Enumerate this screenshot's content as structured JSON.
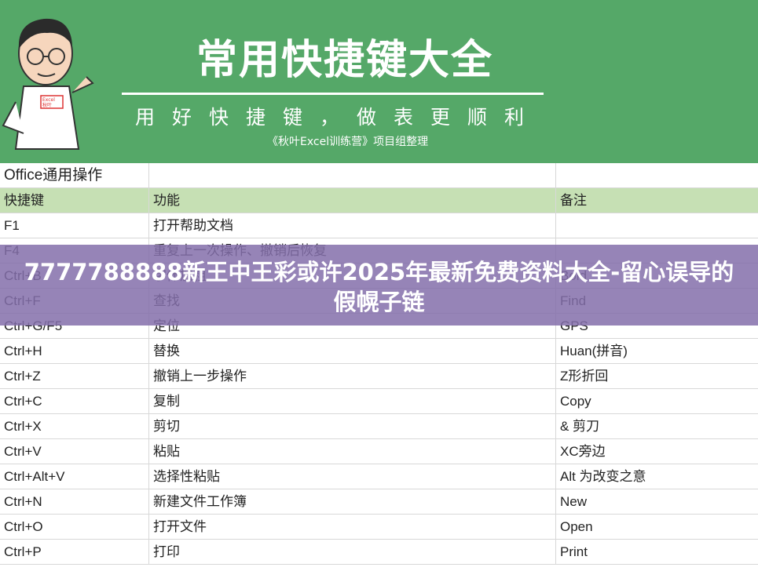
{
  "banner": {
    "title": "常用快捷键大全",
    "subtitle": "用好快捷键，做表更顺利",
    "credit": "《秋叶Excel训练营》项目组整理",
    "bg_color": "#55a868",
    "mascot_shirt_text_1": "Excel",
    "mascot_shirt_text_2": "秋叶"
  },
  "table": {
    "section_title": "Office通用操作",
    "headers": [
      "快捷键",
      "功能",
      "备注"
    ],
    "rows": [
      [
        "F1",
        "打开帮助文档",
        ""
      ],
      [
        "F4",
        "重复上一次操作、撤销后恢复",
        ""
      ],
      [
        "Ctrl+B",
        "字体加粗",
        "Bold"
      ],
      [
        "Ctrl+F",
        "查找",
        "Find"
      ],
      [
        "Ctrl+G/F5",
        "定位",
        "GPS"
      ],
      [
        "Ctrl+H",
        "替换",
        "Huan(拼音)"
      ],
      [
        "Ctrl+Z",
        "撤销上一步操作",
        "Z形折回"
      ],
      [
        "Ctrl+C",
        "复制",
        "Copy"
      ],
      [
        "Ctrl+X",
        "剪切",
        "& 剪刀"
      ],
      [
        "Ctrl+V",
        "粘贴",
        "XC旁边"
      ],
      [
        "Ctrl+Alt+V",
        "选择性粘贴",
        "Alt 为改变之意"
      ],
      [
        "Ctrl+N",
        "新建文件工作簿",
        "New"
      ],
      [
        "Ctrl+O",
        "打开文件",
        "Open"
      ],
      [
        "Ctrl+P",
        "打印",
        "Print"
      ]
    ],
    "header_color": "#c6e0b4"
  },
  "overlay": {
    "text": "7777788888新王中王彩或许2025年最新免费资料大全-留心误导的假幌子链",
    "color": "#846eaa"
  }
}
